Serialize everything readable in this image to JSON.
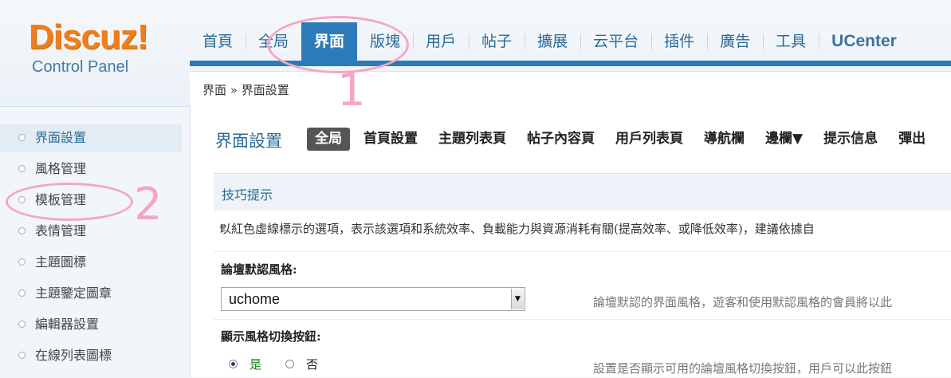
{
  "logo": {
    "brand": "Discuz!",
    "subtitle": "Control Panel"
  },
  "top_nav": {
    "items": [
      {
        "label": "首頁"
      },
      {
        "label": "全局"
      },
      {
        "label": "界面",
        "active": true
      },
      {
        "label": "版塊"
      },
      {
        "label": "用戶"
      },
      {
        "label": "帖子"
      },
      {
        "label": "擴展"
      },
      {
        "label": "云平台"
      },
      {
        "label": "插件"
      },
      {
        "label": "廣告"
      },
      {
        "label": "工具"
      },
      {
        "label": "UCenter"
      }
    ]
  },
  "breadcrumb": {
    "text": "界面 » 界面設置"
  },
  "sidebar": {
    "items": [
      {
        "label": "界面設置",
        "active": true
      },
      {
        "label": "風格管理"
      },
      {
        "label": "模板管理"
      },
      {
        "label": "表情管理"
      },
      {
        "label": "主題圖標"
      },
      {
        "label": "主題鑒定圖章"
      },
      {
        "label": "編輯器設置"
      },
      {
        "label": "在線列表圖標"
      }
    ]
  },
  "main": {
    "title": "界面設置",
    "tabs": [
      {
        "label": "全局",
        "active": true
      },
      {
        "label": "首頁設置"
      },
      {
        "label": "主題列表頁"
      },
      {
        "label": "帖子內容頁"
      },
      {
        "label": "用戶列表頁"
      },
      {
        "label": "導航欄"
      },
      {
        "label": "邊欄▼"
      },
      {
        "label": "提示信息"
      },
      {
        "label": "彈出"
      }
    ],
    "tips": {
      "title": "技巧提示",
      "line": "以紅色虛線標示的選項，表示該選項和系統效率、負載能力與資源消耗有關(提高效率、或降低效率)，建議依據自"
    },
    "settings": {
      "default_style": {
        "label": "論壇默認風格:",
        "value": "uchome",
        "description": "論壇默認的界面風格，遊客和使用默認風格的會員將以此"
      },
      "style_switch": {
        "label": "顯示風格切換按鈕:",
        "yes_label": "是",
        "no_label": "否",
        "selected": "是",
        "description": "設置是否顯示可用的論壇風格切換按鈕，用戶可以此按鈕"
      }
    }
  },
  "annotations": {
    "first": "1",
    "second": "2",
    "color": "#f4a6c6"
  },
  "colors": {
    "accent": "#2c7bb8",
    "logo": "#ef7f1a",
    "link": "#2b6a96"
  }
}
